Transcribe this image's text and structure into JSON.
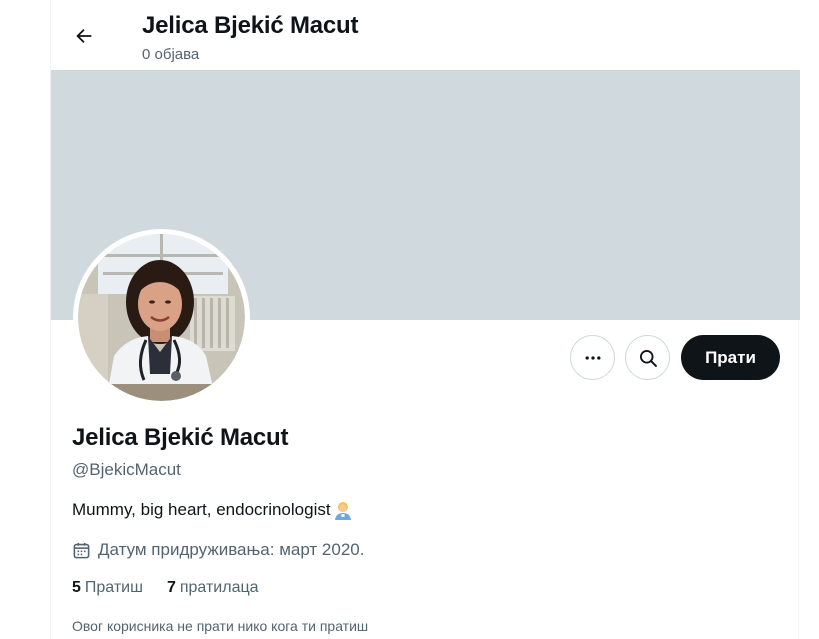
{
  "header": {
    "name": "Jelica Bjekić Macut",
    "posts": "0 објава"
  },
  "profile": {
    "name": "Jelica Bjekić Macut",
    "handle": "@BjekicMacut",
    "bio": "Mummy, big heart, endocrinologist",
    "bio_emoji": "health-worker-emoji",
    "joined": "Датум придруживања: март 2020.",
    "following_count": "5",
    "following_label": "Пратиш",
    "followers_count": "7",
    "followers_label": "пратилаца",
    "mutual_notice": "Овог корисника не прати нико кога ти пратиш"
  },
  "actions": {
    "follow_label": "Прати",
    "more_icon": "more-horizontal-icon",
    "search_icon": "search-icon"
  },
  "colors": {
    "banner": "#cfd9de",
    "primary_text": "#0f1419",
    "secondary_text": "#536471",
    "follow_bg": "#0f1419",
    "border": "#cfd9de"
  }
}
